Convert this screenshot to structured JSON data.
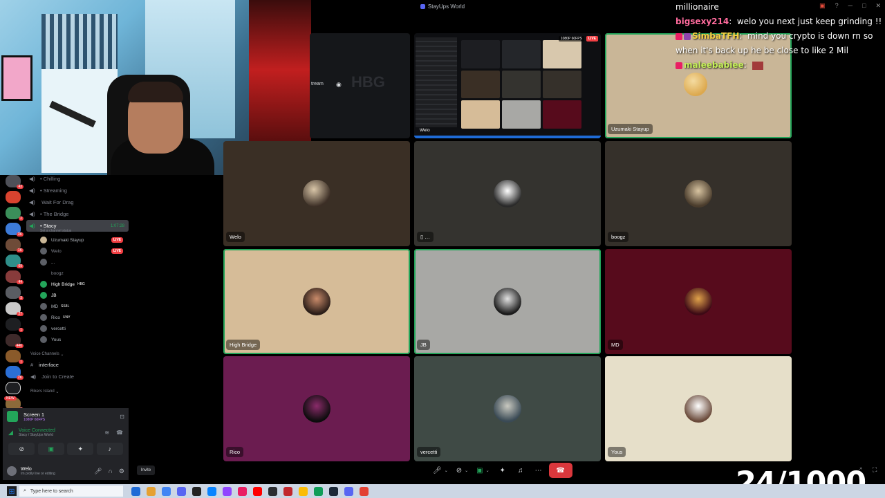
{
  "window": {
    "title": "StayUps World"
  },
  "channels": [
    {
      "name": "Chilling"
    },
    {
      "name": "Streaming"
    },
    {
      "name": "Wait For Drag"
    },
    {
      "name": "The Bridge"
    }
  ],
  "active_channel": {
    "name": "Stacy",
    "time": "1:07:28",
    "status": "Set a channel status"
  },
  "members": [
    {
      "name": "Uzumaki Stayup",
      "live": "LIVE"
    },
    {
      "name": "Welo",
      "live": "LIVE"
    },
    {
      "name": "..."
    },
    {
      "name": "boogz"
    },
    {
      "name": "High Bridge",
      "tag": "HBG"
    },
    {
      "name": "JB"
    },
    {
      "name": "MD",
      "tag": "SS4L"
    },
    {
      "name": "Rico",
      "tag": "UNY"
    },
    {
      "name": "vercetti"
    },
    {
      "name": "Yous"
    }
  ],
  "categories": {
    "voice": "Voice Channels",
    "rikers": "Rikers Island"
  },
  "text_channels": [
    {
      "name": "interface"
    },
    {
      "name": "Join to Create"
    }
  ],
  "new_badge": "NEW",
  "screen_share": {
    "title": "Screen 1",
    "quality": "1080P 60FPS"
  },
  "voice": {
    "status": "Voice Connected",
    "location": "Stacy / StayUps World"
  },
  "user": {
    "name": "Welo",
    "status": "Im prolly live or editing"
  },
  "invite_label": "Invite",
  "stage": {
    "stream_label": "tream",
    "stream_quality": "1080P 60FPS",
    "stream_live": "LIVE",
    "stream_owner": "Welo",
    "tiles": [
      {
        "name": "Uzumaki Stayup",
        "color": "#c9b697"
      },
      {
        "name": "Welo",
        "color": "#3a2f25"
      },
      {
        "name": "",
        "color": "#34332f"
      },
      {
        "name": "boogz",
        "color": "#35302a"
      },
      {
        "name": "High Bridge",
        "color": "#d6bc98"
      },
      {
        "name": "JB",
        "color": "#a8a8a5"
      },
      {
        "name": "MD",
        "color": "#570b1c"
      },
      {
        "name": "Rico",
        "color": "#6b1c50"
      },
      {
        "name": "vercetti",
        "color": "#3f4a45"
      },
      {
        "name": "Yous",
        "color": "#e6dfc9"
      }
    ]
  },
  "chat": [
    {
      "user": "",
      "text": "millionaire"
    },
    {
      "user": "bigsexy214",
      "text": "welo you next just keep grinding !!"
    },
    {
      "user": "SimbaTFH",
      "text": "mind you crypto is down rn so when it's back up he be close to like 2 Mil"
    },
    {
      "user": "maleebabiee",
      "text": ""
    }
  ],
  "counter": "24/1000",
  "taskbar": {
    "search_placeholder": "Type here to search"
  }
}
